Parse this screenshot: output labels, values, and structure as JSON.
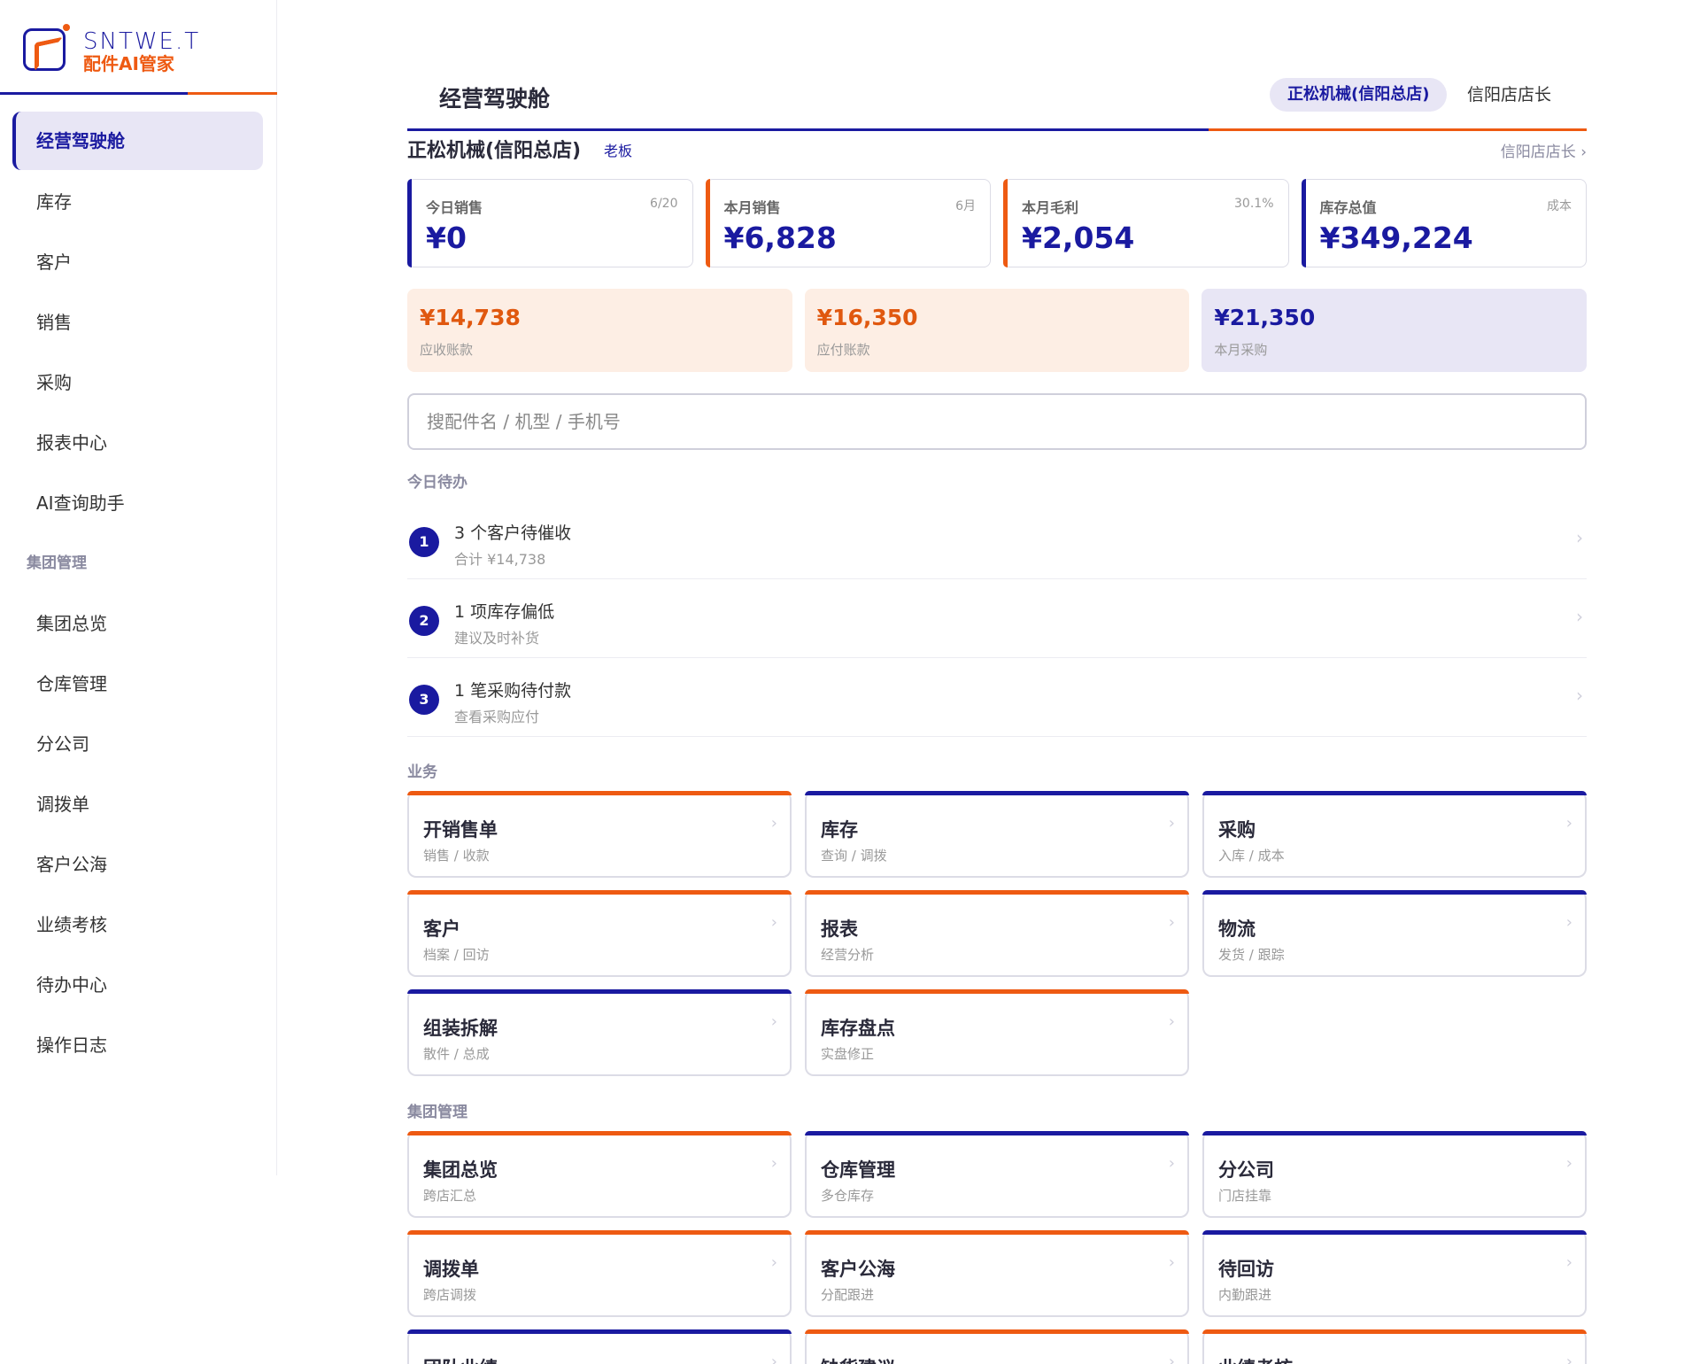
{
  "brand": {
    "name": "SNTWE.T",
    "tagline": "配件AI管家",
    "colors": {
      "primary": "#1a1aa0",
      "accent": "#ee5a12"
    }
  },
  "sidebar": {
    "items": [
      {
        "label": "经营驾驶舱"
      },
      {
        "label": "库存"
      },
      {
        "label": "客户"
      },
      {
        "label": "销售"
      },
      {
        "label": "采购"
      },
      {
        "label": "报表中心"
      },
      {
        "label": "AI查询助手"
      }
    ],
    "group_label": "集团管理",
    "group_items": [
      {
        "label": "集团总览"
      },
      {
        "label": "仓库管理"
      },
      {
        "label": "分公司"
      },
      {
        "label": "调拨单"
      },
      {
        "label": "客户公海"
      },
      {
        "label": "业绩考核"
      },
      {
        "label": "待办中心"
      },
      {
        "label": "操作日志"
      }
    ]
  },
  "header": {
    "title": "经营驾驶舱",
    "store_chip": "正松机械(信阳总店)",
    "role": "信阳店店长"
  },
  "store": {
    "name": "正松机械(信阳总店)",
    "role_badge": "老板",
    "switch_link": "信阳店店长 ›"
  },
  "kpis": [
    {
      "label": "今日销售",
      "tag": "6/20",
      "value": "¥0"
    },
    {
      "label": "本月销售",
      "tag": "6月",
      "value": "¥6,828"
    },
    {
      "label": "本月毛利",
      "tag": "30.1%",
      "value": "¥2,054"
    },
    {
      "label": "库存总值",
      "tag": "成本",
      "value": "¥349,224"
    }
  ],
  "money": [
    {
      "value": "¥14,738",
      "label": "应收账款"
    },
    {
      "value": "¥16,350",
      "label": "应付账款"
    },
    {
      "value": "¥21,350",
      "label": "本月采购"
    }
  ],
  "search": {
    "placeholder": "搜配件名 / 机型 / 手机号"
  },
  "todo": {
    "title": "今日待办",
    "items": [
      {
        "num": "1",
        "title": "3 个客户待催收",
        "sub": "合计 ¥14,738"
      },
      {
        "num": "2",
        "title": "1 项库存偏低",
        "sub": "建议及时补货"
      },
      {
        "num": "3",
        "title": "1 笔采购待付款",
        "sub": "查看采购应付"
      }
    ]
  },
  "business": {
    "title": "业务",
    "tiles": [
      {
        "title": "开销售单",
        "sub": "销售 / 收款"
      },
      {
        "title": "库存",
        "sub": "查询 / 调拨"
      },
      {
        "title": "采购",
        "sub": "入库 / 成本"
      },
      {
        "title": "客户",
        "sub": "档案 / 回访"
      },
      {
        "title": "报表",
        "sub": "经营分析"
      },
      {
        "title": "物流",
        "sub": "发货 / 跟踪"
      },
      {
        "title": "组装拆解",
        "sub": "散件 / 总成"
      },
      {
        "title": "库存盘点",
        "sub": "实盘修正"
      }
    ]
  },
  "group": {
    "title": "集团管理",
    "tiles": [
      {
        "title": "集团总览",
        "sub": "跨店汇总"
      },
      {
        "title": "仓库管理",
        "sub": "多仓库存"
      },
      {
        "title": "分公司",
        "sub": "门店挂靠"
      },
      {
        "title": "调拨单",
        "sub": "跨店调拨"
      },
      {
        "title": "客户公海",
        "sub": "分配跟进"
      },
      {
        "title": "待回访",
        "sub": "内勤跟进"
      },
      {
        "title": "团队业绩",
        "sub": ""
      },
      {
        "title": "缺货建议",
        "sub": ""
      },
      {
        "title": "业绩考核",
        "sub": ""
      }
    ]
  },
  "icons": {
    "chevron": "chevron-right-icon"
  },
  "chevron_glyph": "›"
}
